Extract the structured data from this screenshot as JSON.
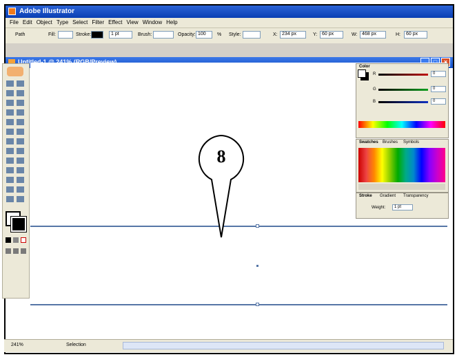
{
  "app": {
    "title": "Adobe Illustrator"
  },
  "menu": [
    "File",
    "Edit",
    "Object",
    "Type",
    "Select",
    "Filter",
    "Effect",
    "View",
    "Window",
    "Help"
  ],
  "control_bar": {
    "selection": "Path",
    "fill_label": "Fill:",
    "stroke_label": "Stroke:",
    "stroke_weight": "1 pt",
    "brush_label": "Brush:",
    "opacity_label": "Opacity:",
    "opacity_value": "100",
    "opacity_unit": "%",
    "style_label": "Style:",
    "x_label": "X:",
    "x_value": "234 px",
    "y_label": "Y:",
    "y_value": "60 px",
    "w_label": "W:",
    "w_value": "468 px",
    "h_label": "H:",
    "h_value": "60 px"
  },
  "document": {
    "title": "Untitled-1 @ 241% (RGB/Preview)"
  },
  "color_panel": {
    "tab": "Color",
    "channels": [
      {
        "label": "R",
        "value": "0",
        "color": "#c01010"
      },
      {
        "label": "G",
        "value": "0",
        "color": "#10a020"
      },
      {
        "label": "B",
        "value": "0",
        "color": "#1030c0"
      }
    ]
  },
  "swatches_panel": {
    "tabs": [
      "Swatches",
      "Brushes",
      "Symbols"
    ]
  },
  "stroke_panel": {
    "tabs": [
      "Stroke",
      "Gradient",
      "Transparency"
    ],
    "weight_label": "Weight:",
    "weight_value": "1 pt"
  },
  "status_bar": {
    "zoom": "241%",
    "tool": "Selection"
  },
  "callout": {
    "label": "8"
  }
}
